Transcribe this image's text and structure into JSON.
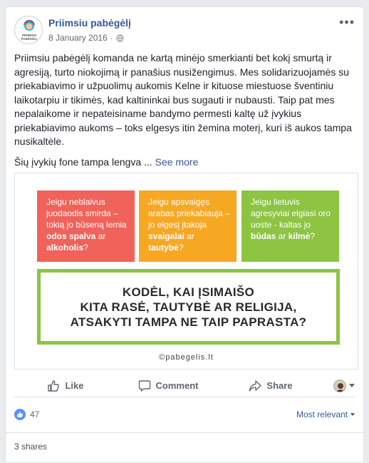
{
  "post": {
    "page_name": "Priimsiu pabėgėlį",
    "date": "8 January 2016",
    "separator": "·",
    "paragraph1": "Priimsiu pabėgėlį komanda ne kartą minėjo smerkianti bet kokį smurtą ir agresiją, turto niokojimą ir panašius nusižengimus. Mes solidarizuojamės su priekabiavimo ir užpuolimų aukomis Kelne ir kituose miestuose šventiniu laikotarpiu ir tikimės, kad kaltininkai bus sugauti ir nubausti. Taip pat mes nepalaikome ir nepateisiname bandymo permesti kaltę už įvykius priekabiavimo aukoms – toks elgesys itin žemina moterį, kuri iš aukos tampa nusikaltėle.",
    "paragraph2": "Šių įvykių fone tampa lengva",
    "ellipsis": "...",
    "see_more": "See more"
  },
  "avatar": {
    "line1": "PRIIMSIU",
    "line2": "PABĖGĖLĮ"
  },
  "image": {
    "box_red": {
      "text_before": "Jeigu neblaivus juodaodis smirda – tokią jo būseną lemia ",
      "bold1": "odos spalva",
      "mid": " ar ",
      "bold2": "alkoholis",
      "end": "?"
    },
    "box_orange": {
      "text_before": "Jeigu apsvaigęs arabas priekabiauja – jo elgesį įtakoja ",
      "bold1": "svaigalai",
      "mid": " ar ",
      "bold2": "tautybė",
      "end": "?"
    },
    "box_green": {
      "text_before": "Jeigu lietuvis agresyviai elgiasi oro uoste - kaltas jo ",
      "bold1": "būdas",
      "mid": " ar ",
      "bold2": "kilmė",
      "end": "?"
    },
    "headline1": "KODĖL, KAI ĮSIMAIŠO",
    "headline2": "KITA RASĖ, TAUTYBĖ AR RELIGIJA,",
    "headline3": "ATSAKYTI TAMPA NE TAIP PAPRASTA?",
    "watermark": "©pabegelis.lt",
    "colors": {
      "red": "#f0625a",
      "orange": "#f7a823",
      "green": "#8dc442"
    }
  },
  "actions": {
    "like": "Like",
    "comment": "Comment",
    "share": "Share"
  },
  "reactions": {
    "count": "47",
    "sort": "Most relevant"
  },
  "shares": {
    "label": "3 shares"
  },
  "icons": [
    "more-icon",
    "globe-icon",
    "like-icon",
    "comment-icon",
    "share-icon",
    "like-badge-icon",
    "caret-down-icon"
  ]
}
